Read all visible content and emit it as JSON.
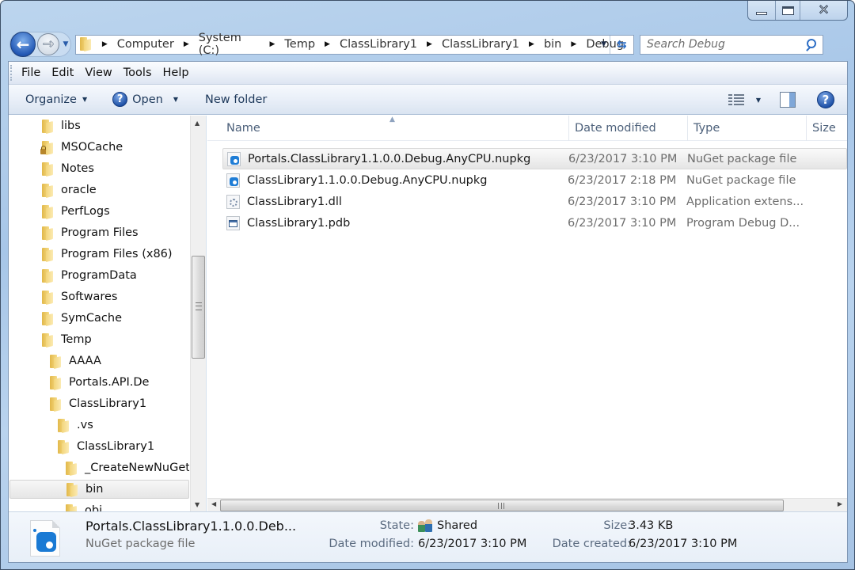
{
  "window": {
    "caption_buttons": [
      "minimize",
      "maximize",
      "close"
    ]
  },
  "navigation": {
    "back_icon": "back-arrow-icon",
    "forward_icon": "forward-arrow-icon",
    "breadcrumb": [
      "Computer",
      "System (C:)",
      "Temp",
      "ClassLibrary1",
      "ClassLibrary1",
      "bin",
      "Debug"
    ],
    "search_placeholder": "Search Debug",
    "search_value": ""
  },
  "menubar": {
    "items": [
      "File",
      "Edit",
      "View",
      "Tools",
      "Help"
    ]
  },
  "toolbar": {
    "organize_label": "Organize",
    "open_label": "Open",
    "new_folder_label": "New folder"
  },
  "nav_pane": {
    "items": [
      {
        "label": "libs",
        "level": 0,
        "locked": false
      },
      {
        "label": "MSOCache",
        "level": 0,
        "locked": true
      },
      {
        "label": "Notes",
        "level": 0,
        "locked": false
      },
      {
        "label": "oracle",
        "level": 0,
        "locked": false
      },
      {
        "label": "PerfLogs",
        "level": 0,
        "locked": false
      },
      {
        "label": "Program Files",
        "level": 0,
        "locked": false
      },
      {
        "label": "Program Files (x86)",
        "level": 0,
        "locked": false
      },
      {
        "label": "ProgramData",
        "level": 0,
        "locked": false
      },
      {
        "label": "Softwares",
        "level": 0,
        "locked": false
      },
      {
        "label": "SymCache",
        "level": 0,
        "locked": false
      },
      {
        "label": "Temp",
        "level": 0,
        "locked": false
      },
      {
        "label": "AAAA",
        "level": 1,
        "locked": false
      },
      {
        "label": "Portals.API.De",
        "level": 1,
        "locked": false
      },
      {
        "label": "ClassLibrary1",
        "level": 1,
        "locked": false
      },
      {
        "label": ".vs",
        "level": 2,
        "locked": false
      },
      {
        "label": "ClassLibrary1",
        "level": 2,
        "locked": false
      },
      {
        "label": "_CreateNewNuGetP",
        "level": 3,
        "locked": false
      },
      {
        "label": "bin",
        "level": 3,
        "locked": false,
        "selected": true
      },
      {
        "label": "obj",
        "level": 3,
        "locked": false
      }
    ]
  },
  "file_list": {
    "columns": [
      "Name",
      "Date modified",
      "Type",
      "Size"
    ],
    "sort_column": "Name",
    "rows": [
      {
        "name": "Portals.ClassLibrary1.1.0.0.Debug.AnyCPU.nupkg",
        "date": "6/23/2017 3:10 PM",
        "type": "NuGet package file",
        "size": "",
        "icon": "nupkg",
        "selected": true
      },
      {
        "name": "ClassLibrary1.1.0.0.Debug.AnyCPU.nupkg",
        "date": "6/23/2017 2:18 PM",
        "type": "NuGet package file",
        "size": "",
        "icon": "nupkg",
        "selected": false
      },
      {
        "name": "ClassLibrary1.dll",
        "date": "6/23/2017 3:10 PM",
        "type": "Application extens...",
        "size": "",
        "icon": "dll",
        "selected": false
      },
      {
        "name": "ClassLibrary1.pdb",
        "date": "6/23/2017 3:10 PM",
        "type": "Program Debug D...",
        "size": "",
        "icon": "pdb",
        "selected": false
      }
    ]
  },
  "details": {
    "title": "Portals.ClassLibrary1.1.0.0.Deb...",
    "subtitle": "NuGet package file",
    "state_label": "State:",
    "state_value": "Shared",
    "size_label": "Size:",
    "size_value": "3.43 KB",
    "modified_label": "Date modified:",
    "modified_value": "6/23/2017 3:10 PM",
    "created_label": "Date created:",
    "created_value": "6/23/2017 3:10 PM"
  }
}
